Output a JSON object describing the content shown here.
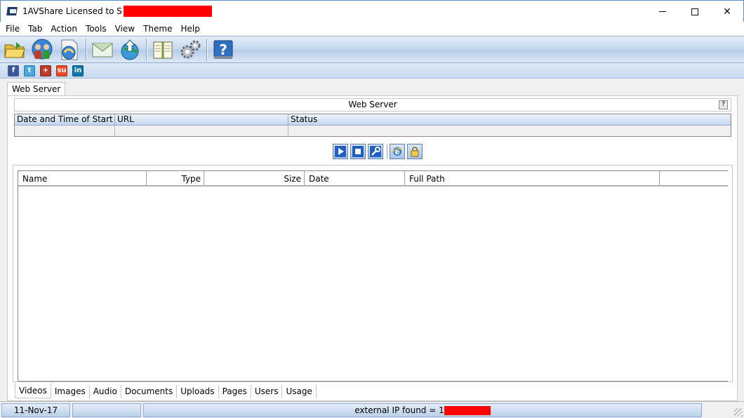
{
  "window": {
    "title": "1AVShare Licensed to S"
  },
  "menu": [
    "File",
    "Tab",
    "Action",
    "Tools",
    "View",
    "Theme",
    "Help"
  ],
  "toolbar": {
    "buttons": [
      "open-folder-icon",
      "users-icon",
      "share-icon",
      "mail-icon",
      "globe-upload-icon",
      "book-icon",
      "settings-gears-icon",
      "help-icon"
    ]
  },
  "social": [
    "facebook-icon",
    "twitter-icon",
    "plus-icon",
    "stumbleupon-icon",
    "linkedin-icon"
  ],
  "main": {
    "tab_label": "Web Server",
    "server_header": "Web Server",
    "help_label": "?",
    "server_table": {
      "columns": [
        "Date and Time of Start",
        "URL",
        "Status"
      ]
    },
    "file_table": {
      "columns": [
        "Name",
        "Type",
        "Size",
        "Date",
        "Full Path"
      ]
    },
    "bottom_tabs": [
      "Videos",
      "Images",
      "Audio",
      "Documents",
      "Uploads",
      "Pages",
      "Users",
      "Usage"
    ],
    "active_bottom_tab": "Videos"
  },
  "status": {
    "date": "11-Nov-17",
    "ip_text": "external IP found = 1"
  },
  "colors": {
    "accent_blue": "#1f5fbf",
    "redaction": "#ff0000",
    "header_gradient": "#c2d6ee"
  }
}
